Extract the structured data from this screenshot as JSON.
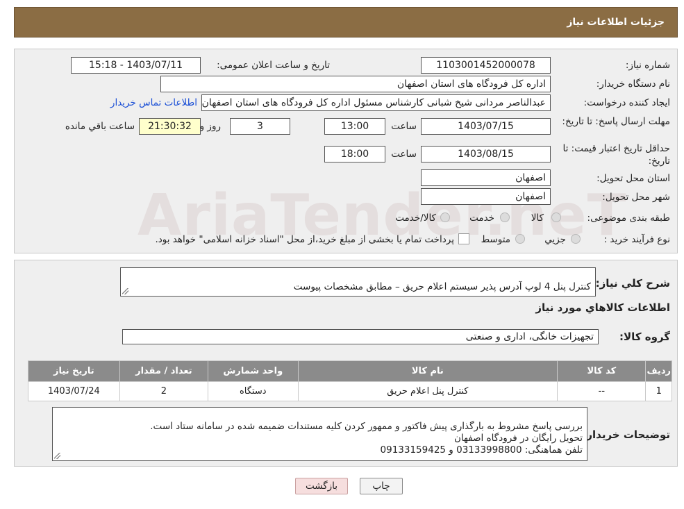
{
  "header": {
    "title": "جزئیات اطلاعات نیاز"
  },
  "form": {
    "need_number_label": "شماره نیاز:",
    "need_number": "1103001452000078",
    "announce_datetime_label": "تاریخ و ساعت اعلان عمومی:",
    "announce_datetime": "1403/07/11 - 15:18",
    "buyer_org_label": "نام دستگاه خریدار:",
    "buyer_org": "اداره کل فرودگاه های استان اصفهان",
    "creator_label": "ایجاد کننده درخواست:",
    "creator": "عبدالناصر مردانی شیخ شبانی کارشناس مسئول  اداره کل فرودگاه های استان اصفهان",
    "contact_link": "اطلاعات تماس خریدار",
    "deadline_label": "مهلت ارسال پاسخ: تا تاریخ:",
    "deadline_date": "1403/07/15",
    "time_label": "ساعت",
    "deadline_time": "13:00",
    "days_value": "3",
    "days_label": "روز و",
    "remaining_time": "21:30:32",
    "remaining_label": "ساعت باقي مانده",
    "validity_label": "حداقل تاریخ اعتبار قیمت: تا تاریخ:",
    "validity_date": "1403/08/15",
    "validity_time": "18:00",
    "province_label": "استان محل تحویل:",
    "province": "اصفهان",
    "city_label": "شهر محل تحویل:",
    "city": "اصفهان",
    "category_label": "طبقه بندی موضوعی:",
    "category_options": [
      "کالا",
      "خدمت",
      "کالا/خدمت"
    ],
    "process_label": "نوع فرآیند خرید :",
    "process_options": [
      "جزيي",
      "متوسط"
    ],
    "process_note": "پرداخت تمام یا بخشی از مبلغ خرید،از محل \"اسناد خزانه اسلامی\" خواهد بود."
  },
  "watermark": {
    "text": "AriaTender.neT"
  },
  "summary": {
    "label": "شرح كلي نياز:",
    "text": "کنترل پنل 4 لوپ آدرس پذیر سیستم اعلام حریق – مطابق مشخصات پیوست"
  },
  "goods": {
    "section_title": "اطلاعات كالاهاي مورد نياز",
    "group_label": "گروه كالا:",
    "group_value": "تجهیزات خانگی، اداری و صنعتی",
    "columns": [
      "رديف",
      "كد كالا",
      "نام كالا",
      "واحد شمارش",
      "تعداد / مقدار",
      "تاريخ نياز"
    ],
    "rows": [
      [
        "1",
        "--",
        "کنترل پنل اعلام حریق",
        "دستگاه",
        "2",
        "1403/07/24"
      ]
    ]
  },
  "buyer_notes": {
    "label": "توضیحات خریدار:",
    "text": "بررسی پاسخ مشروط  به بارگذاری پیش فاکتور و ممهور کردن کلیه مستندات ضمیمه شده در سامانه  ستاد است.\nتحویل رایگان در فرودگاه اصفهان\nتلفن هماهنگی: 03133998800 و 09133159425"
  },
  "buttons": {
    "print": "چاپ",
    "back": "بازگشت"
  },
  "colors": {
    "header": "#8b6d44",
    "panel": "#efefef",
    "table_header": "#8b8b8b",
    "link": "#1a4fd6",
    "back_button": "#f6dede"
  }
}
